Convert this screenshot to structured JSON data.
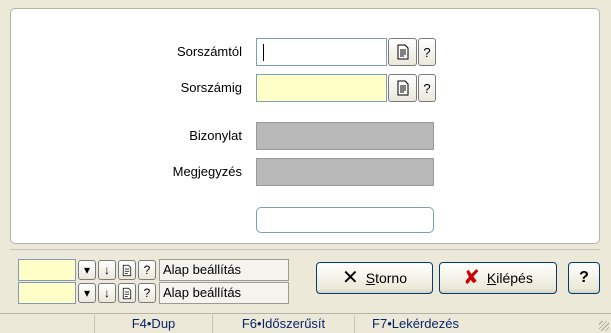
{
  "form": {
    "sorszamtol_label": "Sorszámtól",
    "sorszamtol_value": "",
    "sorszamig_label": "Sorszámig",
    "sorszamig_value": "",
    "bizonylat_label": "Bizonylat",
    "megjegyzes_label": "Megjegyzés",
    "help_glyph": "?"
  },
  "presets": [
    {
      "label": "Alap beállítás",
      "value": ""
    },
    {
      "label": "Alap beállítás",
      "value": ""
    }
  ],
  "buttons": {
    "storno_first": "S",
    "storno_rest": "torno",
    "kilepes_first": "K",
    "kilepes_rest": "ilépés",
    "help": "?"
  },
  "statusbar": {
    "f4": "F4•Dup",
    "f6": "F6•Időszerűsít",
    "f7": "F7•Lekérdezés"
  },
  "colors": {
    "input_yellow": "#ffffc8",
    "disabled_gray": "#b9b9b9",
    "kilepes_x": "#cc0000"
  }
}
